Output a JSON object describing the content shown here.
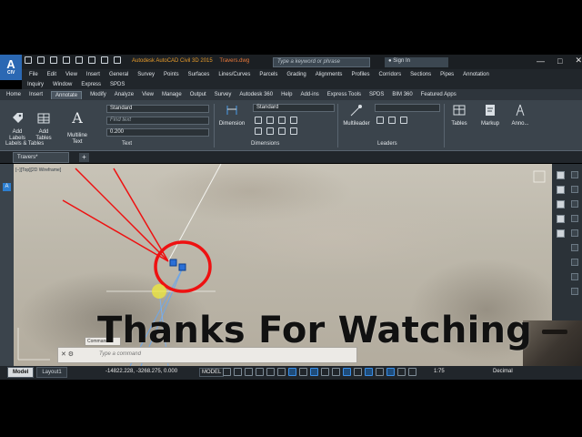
{
  "title_bar": {
    "app_title": "Autodesk AutoCAD Civil 3D 2015",
    "file_name": "Travers.dwg",
    "search_placeholder": "Type a keyword or phrase",
    "sign_in": "Sign In",
    "logo_text": "A",
    "logo_sub": "CIV"
  },
  "menu_row1": [
    "File",
    "Edit",
    "View",
    "Insert",
    "General",
    "Survey",
    "Points",
    "Surfaces",
    "Lines/Curves",
    "Parcels",
    "Grading",
    "Alignments",
    "Profiles",
    "Corridors",
    "Sections",
    "Pipes",
    "Annotation"
  ],
  "menu_row2": [
    "Inquiry",
    "Window",
    "Express",
    "SPDS"
  ],
  "ribbon_tabs": [
    "Home",
    "Insert",
    "Annotate",
    "Modify",
    "Analyze",
    "View",
    "Manage",
    "Output",
    "Survey",
    "Autodesk 360",
    "Help",
    "Add-ins",
    "Express Tools",
    "SPDS",
    "BIM 360",
    "Featured Apps"
  ],
  "ribbon": {
    "add_labels": "Add\nLabels",
    "add_tables": "Add\nTables",
    "multiline_text": "Multiline\nText",
    "text_style": "Standard",
    "find_text_placeholder": "Find text",
    "text_height": "0.200",
    "dimension": "Dimension",
    "dim_style": "Standard",
    "multileader": "Multileader",
    "tables": "Tables",
    "markup": "Markup",
    "annotation_scale": "Anno...",
    "panels": {
      "labels_tables": "Labels & Tables",
      "text": "Text",
      "dimensions": "Dimensions",
      "leaders": "Leaders"
    }
  },
  "file_tabs": {
    "current": "Travers*",
    "new_tab": "+"
  },
  "viewport_label": "[−][Top][2D Wireframe]",
  "command_line": {
    "tag": "Command:",
    "placeholder": "Type a command"
  },
  "overlay_text": "Thanks For Watching",
  "status_bar": {
    "layout_tabs": [
      "Model",
      "Layout1"
    ],
    "coordinates": "-14822.228, -3268.275, 0.000",
    "model_button": "MODEL",
    "scale": "1:75",
    "units": "Decimal"
  },
  "colors": {
    "accent_blue": "#2b68b3",
    "drawing_red": "#ee1111",
    "title_orange": "#e79b2a"
  }
}
